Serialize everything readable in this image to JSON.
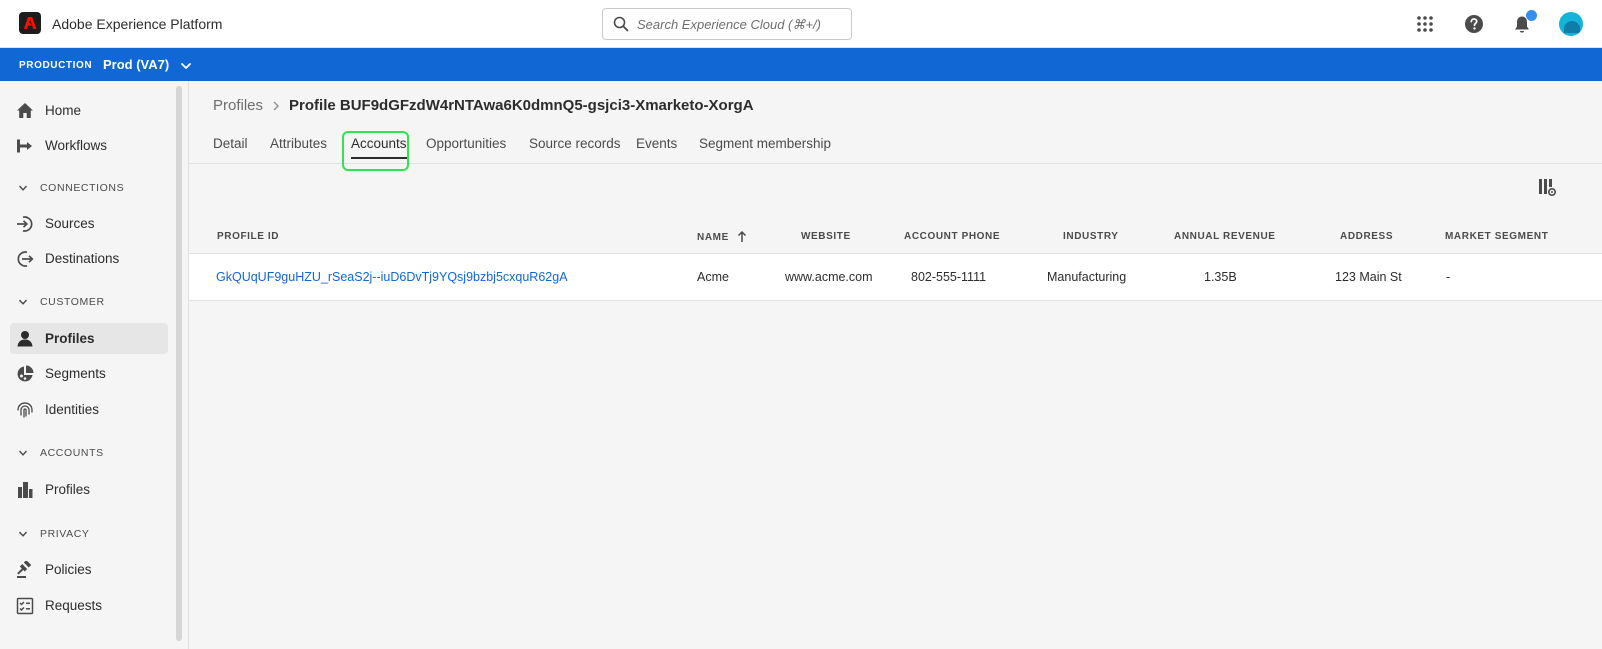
{
  "header": {
    "app_title": "Adobe Experience Platform",
    "search_placeholder": "Search Experience Cloud (⌘+/)",
    "icons": [
      "apps-grid-icon",
      "help-icon",
      "notifications-icon",
      "user-avatar"
    ]
  },
  "environment": {
    "label": "PRODUCTION",
    "sandbox": "Prod (VA7)"
  },
  "sidebar": {
    "items": [
      {
        "label": "Home",
        "icon": "home-icon"
      },
      {
        "label": "Workflows",
        "icon": "workflows-icon"
      },
      {
        "section": "CONNECTIONS"
      },
      {
        "label": "Sources",
        "icon": "sources-icon"
      },
      {
        "label": "Destinations",
        "icon": "destinations-icon"
      },
      {
        "section": "CUSTOMER"
      },
      {
        "label": "Profiles",
        "icon": "user-icon",
        "active": true
      },
      {
        "label": "Segments",
        "icon": "segments-icon"
      },
      {
        "label": "Identities",
        "icon": "fingerprint-icon"
      },
      {
        "section": "ACCOUNTS"
      },
      {
        "label": "Profiles",
        "icon": "building-icon"
      },
      {
        "section": "PRIVACY"
      },
      {
        "label": "Policies",
        "icon": "policies-icon"
      },
      {
        "label": "Requests",
        "icon": "requests-icon"
      }
    ]
  },
  "breadcrumb": {
    "parent": "Profiles",
    "current": "Profile BUF9dGFzdW4rNTAwa6K0dmnQ5-gsjci3-Xmarketo-XorgA"
  },
  "tabs": [
    {
      "label": "Detail"
    },
    {
      "label": "Attributes"
    },
    {
      "label": "Accounts",
      "active": true
    },
    {
      "label": "Opportunities"
    },
    {
      "label": "Source records"
    },
    {
      "label": "Events"
    },
    {
      "label": "Segment membership"
    }
  ],
  "table": {
    "columns": [
      "PROFILE ID",
      "NAME",
      "WEBSITE",
      "ACCOUNT PHONE",
      "INDUSTRY",
      "ANNUAL REVENUE",
      "ADDRESS",
      "MARKET SEGMENT"
    ],
    "sorted_column": "NAME",
    "rows": [
      [
        "GkQUqUF9guHZU_rSeaS2j--iuD6DvTj9YQsj9bzbj5cxquR62gA",
        "Acme",
        "www.acme.com",
        "802-555-1111",
        "Manufacturing",
        "1.35B",
        "123 Main St",
        "-"
      ]
    ]
  },
  "colors": {
    "accent_blue": "#1167d4",
    "focus_green": "#2ee64c",
    "notification_dot": "#378ef0"
  }
}
